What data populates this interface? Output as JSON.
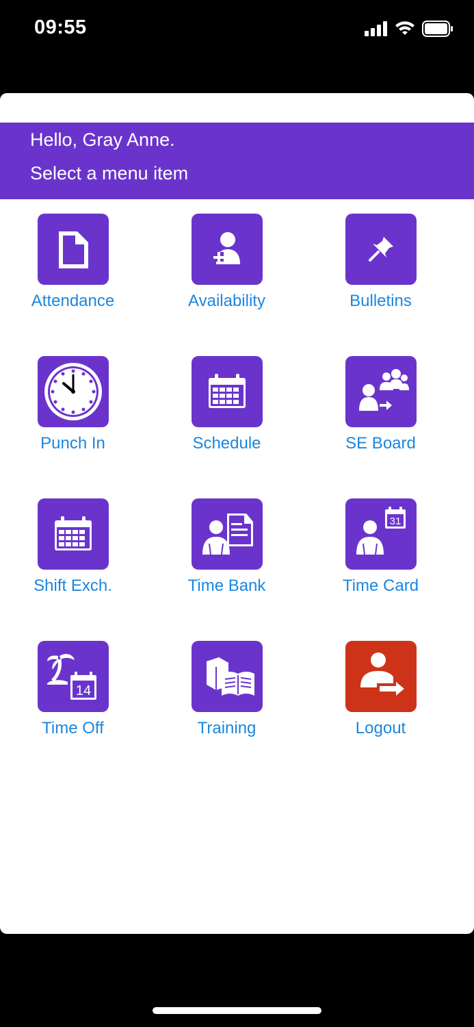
{
  "status_bar": {
    "time": "09:55",
    "icons": [
      "signal-icon",
      "wifi-icon",
      "battery-icon"
    ]
  },
  "colors": {
    "accent": "#6A34CC",
    "logout": "#CC3318",
    "link": "#1A86E0",
    "background": "#000000",
    "sheet": "#FFFFFF"
  },
  "header": {
    "greeting": "Hello, Gray Anne.",
    "subtitle": "Select a menu item"
  },
  "menu": {
    "items": [
      {
        "label": "Attendance",
        "icon": "document-icon"
      },
      {
        "label": "Availability",
        "icon": "user-plus-icon"
      },
      {
        "label": "Bulletins",
        "icon": "pushpin-icon"
      },
      {
        "label": "Punch In",
        "icon": "clock-icon"
      },
      {
        "label": "Schedule",
        "icon": "calendar-icon"
      },
      {
        "label": "SE Board",
        "icon": "group-icon"
      },
      {
        "label": "Shift Exch.",
        "icon": "calendar-icon"
      },
      {
        "label": "Time Bank",
        "icon": "user-document-icon"
      },
      {
        "label": "Time Card",
        "icon": "user-calendar-icon"
      },
      {
        "label": "Time Off",
        "icon": "palm-calendar-icon",
        "date": "14"
      },
      {
        "label": "Training",
        "icon": "books-icon"
      },
      {
        "label": "Logout",
        "icon": "logout-icon"
      }
    ],
    "time_card_date": "31"
  }
}
